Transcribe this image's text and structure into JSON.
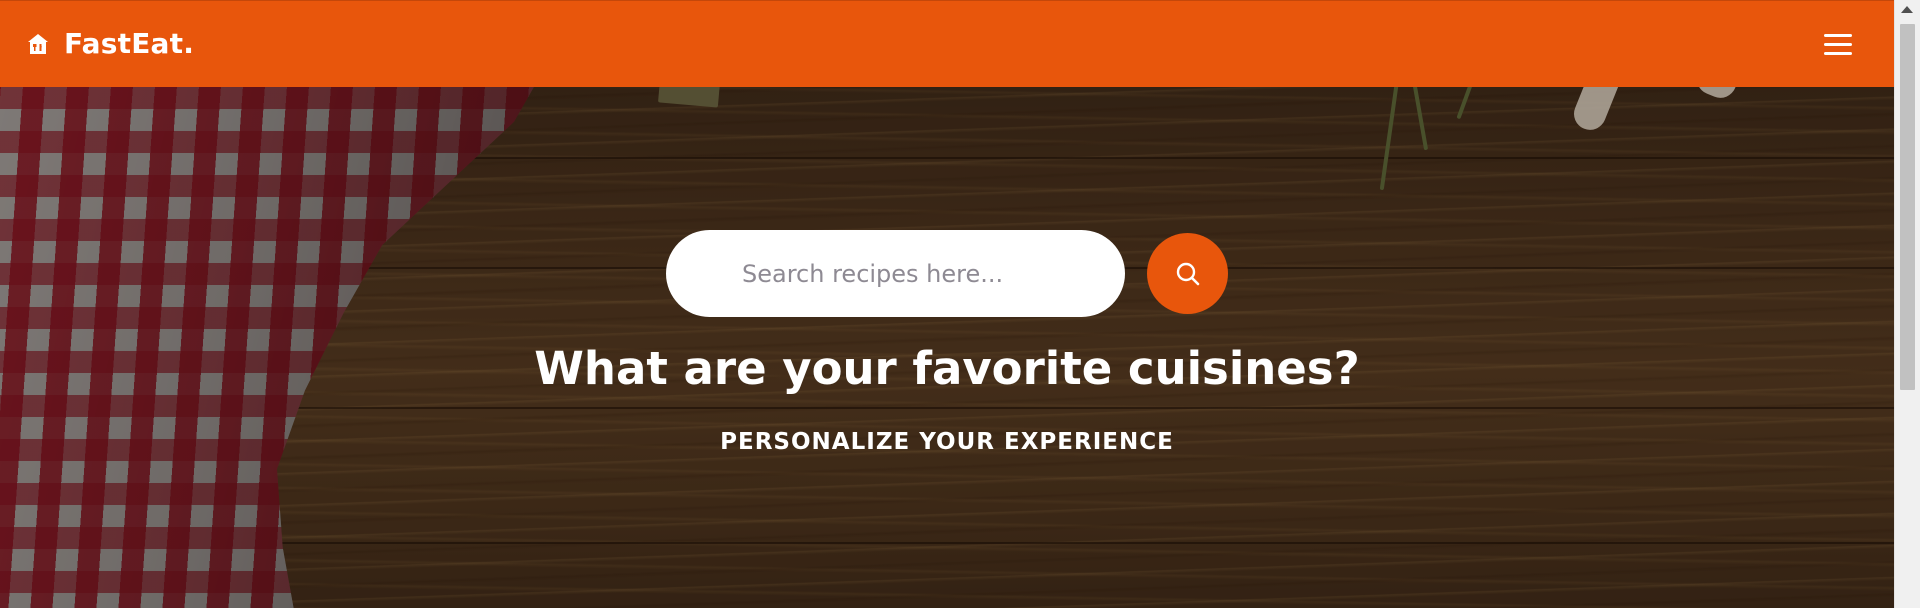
{
  "navbar": {
    "brand_name": "FastEat.",
    "brand_icon": "home-restaurant-icon",
    "menu_icon": "hamburger-menu-icon",
    "background_color": "#e8560c"
  },
  "hero": {
    "search": {
      "placeholder": "Search recipes here...",
      "value": "",
      "button_icon": "search-icon"
    },
    "title": "What are your favorite cuisines?",
    "subtitle": "PERSONALIZE YOUR EXPERIENCE"
  },
  "colors": {
    "accent": "#e8560c",
    "text_on_dark": "#ffffff"
  }
}
